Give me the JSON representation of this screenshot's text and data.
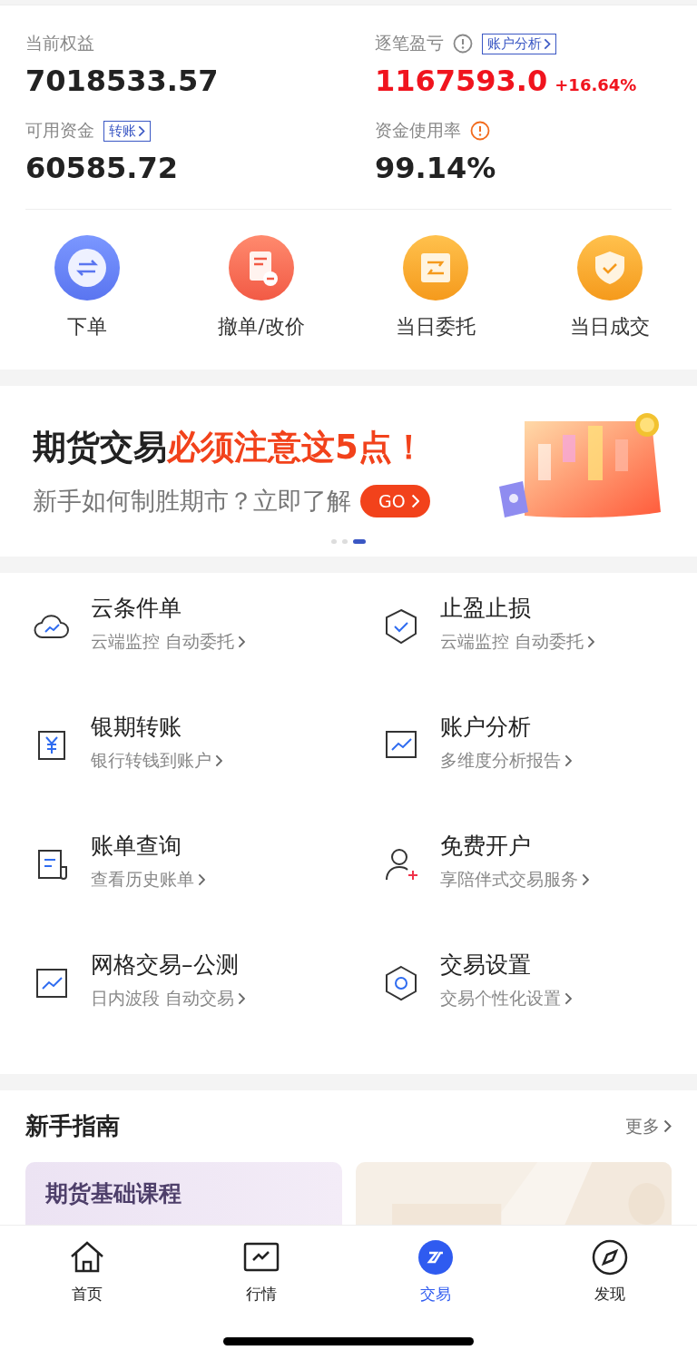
{
  "stats": [
    {
      "label": "当前权益",
      "value": "7018533.57"
    },
    {
      "label": "逐笔盈亏",
      "info": true,
      "link": "账户分析",
      "value": "1167593.0",
      "change": "+16.64%",
      "positive": true
    },
    {
      "label": "可用资金",
      "link": "转账",
      "value": "60585.72"
    },
    {
      "label": "资金使用率",
      "info": true,
      "warning": true,
      "value": "99.14%"
    }
  ],
  "quick_actions": [
    {
      "label": "下单"
    },
    {
      "label": "撤单/改价"
    },
    {
      "label": "当日委托"
    },
    {
      "label": "当日成交"
    }
  ],
  "banner": {
    "title": "期货交易",
    "title_highlight": "必须注意这5点！",
    "subtitle": "新手如何制胜期市？立即了解",
    "button": "GO",
    "dots": [
      {
        "selected": false
      },
      {
        "selected": false
      },
      {
        "selected": true
      }
    ]
  },
  "tools": [
    {
      "title": "云条件单",
      "subtitle": "云端监控 自动委托"
    },
    {
      "title": "止盈止损",
      "subtitle": "云端监控 自动委托"
    },
    {
      "title": "银期转账",
      "subtitle": "银行转钱到账户"
    },
    {
      "title": "账户分析",
      "subtitle": "多维度分析报告"
    },
    {
      "title": "账单查询",
      "subtitle": "查看历史账单"
    },
    {
      "title": "免费开户",
      "subtitle": "享陪伴式交易服务"
    },
    {
      "title": "网格交易–公测",
      "subtitle": "日内波段 自动交易"
    },
    {
      "title": "交易设置",
      "subtitle": "交易个性化设置"
    }
  ],
  "guide": {
    "title": "新手指南",
    "more": "更多",
    "cards": [
      {
        "title": "期货基础课程"
      },
      {
        "kind": "picture"
      }
    ]
  },
  "tab_bar": [
    {
      "label": "首页",
      "selected": false
    },
    {
      "label": "行情",
      "selected": false
    },
    {
      "label": "交易",
      "selected": true
    },
    {
      "label": "发现",
      "selected": false
    }
  ]
}
